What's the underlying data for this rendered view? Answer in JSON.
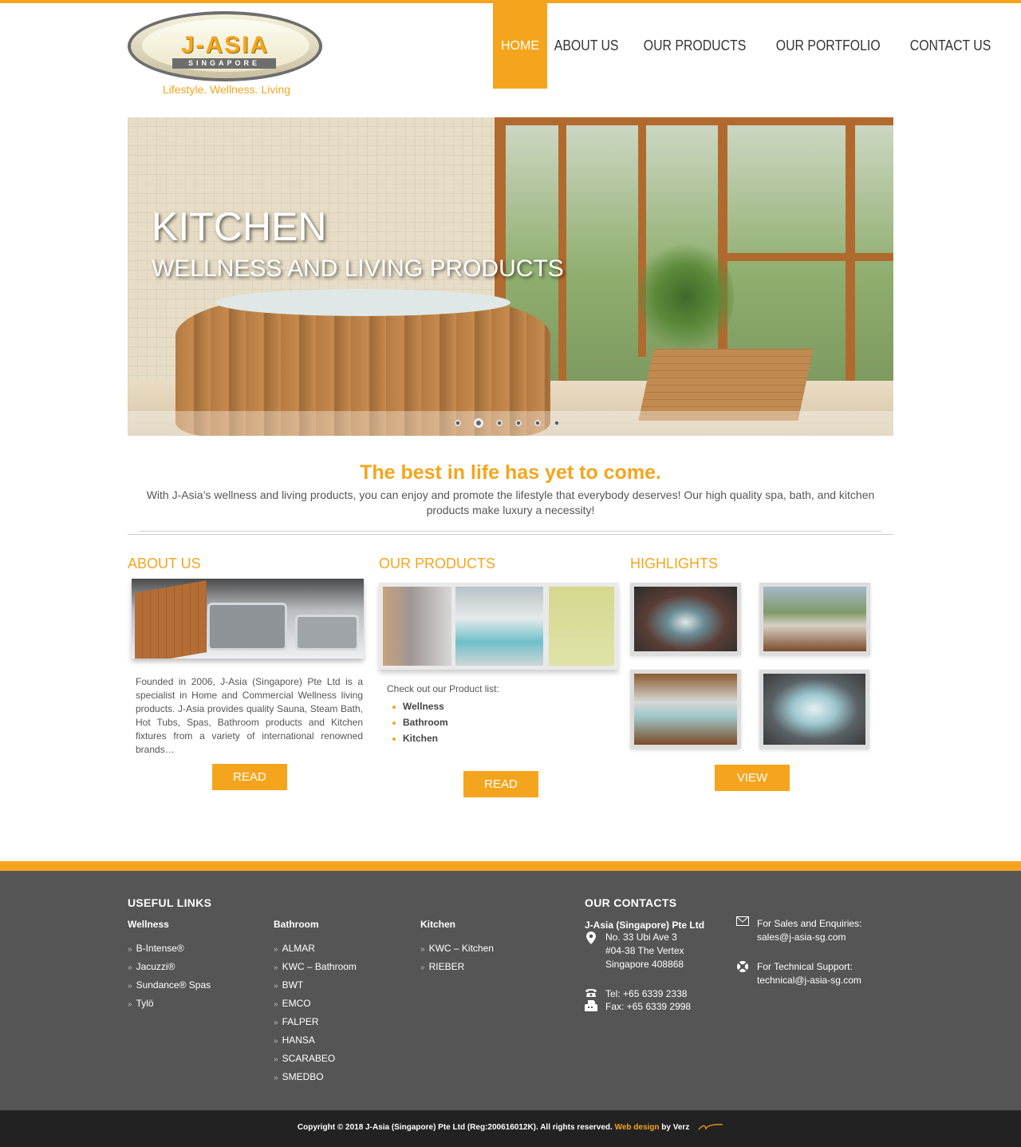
{
  "brand": {
    "name": "J-ASIA",
    "sub": "SINGAPORE",
    "tagline": "Lifestyle. Wellness. Living"
  },
  "nav": [
    {
      "label": "HOME",
      "active": true
    },
    {
      "label": "ABOUT US"
    },
    {
      "label": "OUR PRODUCTS"
    },
    {
      "label": "OUR PORTFOLIO"
    },
    {
      "label": "CONTACT US"
    }
  ],
  "hero": {
    "title": "KITCHEN",
    "subtitle": "WELLNESS AND LIVING PRODUCTS",
    "slide_count": 6,
    "active_slide": 2
  },
  "intro": {
    "title": "The best in life has yet to come.",
    "text": "With J-Asia’s wellness and living products, you can enjoy and promote the lifestyle that everybody deserves! Our high quality spa, bath, and kitchen products make luxury a necessity!"
  },
  "about": {
    "heading": "ABOUT US",
    "text": "Founded in 2006, J-Asia (Singapore) Pte Ltd is a specialist in Home and Commercial Wellness living products. J-Asia provides quality Sauna, Steam Bath, Hot Tubs, Spas, Bathroom products and Kitchen fixtures from a variety of international renowned brands…",
    "button": "READ MORE"
  },
  "products": {
    "heading": "OUR PRODUCTS",
    "label": "Check out our Product list:",
    "items": [
      "Wellness",
      "Bathroom",
      "Kitchen"
    ],
    "button": "READ MORE"
  },
  "highlights": {
    "heading": "HIGHLIGHTS",
    "button": "VIEW MORE"
  },
  "footer": {
    "useful_links_heading": "USEFUL LINKS",
    "wellness": {
      "title": "Wellness",
      "links": [
        "B-Intense®",
        "Jacuzzi®",
        "Sundance® Spas",
        "Tylö"
      ]
    },
    "bathroom": {
      "title": "Bathroom",
      "links": [
        "ALMAR",
        "KWC – Bathroom",
        "BWT",
        "EMCO",
        "FALPER",
        "HANSA",
        "SCARABEO",
        "SMEDBO"
      ]
    },
    "kitchen": {
      "title": "Kitchen",
      "links": [
        "KWC – Kitchen",
        "RIEBER"
      ]
    },
    "contacts_heading": "OUR CONTACTS",
    "company": "J-Asia (Singapore) Pte Ltd",
    "address": [
      "No. 33 Ubi Ave 3",
      "#04-38 The Vertex",
      "Singapore 408868"
    ],
    "tel": "Tel: +65 6339 2338",
    "fax": "Fax: +65 6339 2998",
    "sales_label": "For Sales and Enquiries:",
    "sales_email": "sales@j-asia-sg.com",
    "tech_label": "For Technical Support:",
    "tech_email": "technical@j-asia-sg.com"
  },
  "copyright": {
    "text": "Copyright © 2018 J-Asia (Singapore) Pte Ltd (Reg:200616012K). All rights reserved.",
    "design_link": "Web design",
    "by": "by Verz"
  },
  "colors": {
    "accent": "#f5a51d",
    "footer_bg": "#555555",
    "copyright_bg": "#222222"
  }
}
